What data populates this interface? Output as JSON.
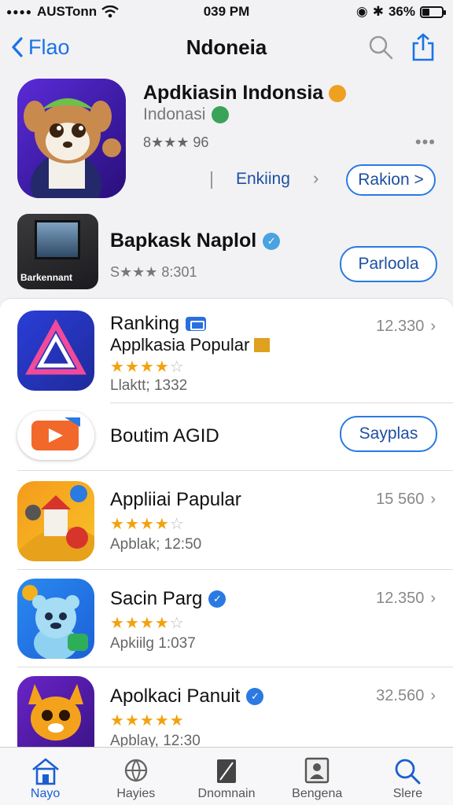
{
  "status": {
    "carrier": "AUSTonn",
    "time": "039 PM",
    "battery_text": "36%",
    "battery_level": 0.36
  },
  "nav": {
    "back_label": "Flao",
    "title": "Ndoneia"
  },
  "hero": {
    "title": "Apdkiasin Indonsia",
    "subtitle": "Indonasi",
    "rating": "8★★★ 96",
    "more": "•••",
    "link_label": "Enkiing",
    "button_label": "Rakion >"
  },
  "hero2": {
    "title": "Bapkask Naplol",
    "icon_caption": "Barkennant",
    "rating": "S★★★ 8:301",
    "button_label": "Parloola"
  },
  "list": {
    "rows": [
      {
        "title": "Ranking",
        "subtitle": "Applkasia Popular",
        "rating": 4,
        "meta": "Llaktt; 1332",
        "count": "12.330"
      },
      {
        "title": "Boutim AGID",
        "button_label": "Sayplas"
      },
      {
        "title": "Appliiai Papular",
        "rating": 4,
        "meta": "Apblak; 12:50",
        "count": "15 560"
      },
      {
        "title": "Sacin Parg",
        "rating": 4,
        "meta": "Apkiilg 1:037",
        "count": "12.350"
      },
      {
        "title": "Apolkaci Panuit",
        "rating": 4.5,
        "meta": "Apblay, 12:30",
        "count": "32.560"
      }
    ]
  },
  "tabs": [
    {
      "label": "Nayo",
      "icon": "home-icon"
    },
    {
      "label": "Hayies",
      "icon": "globe-icon"
    },
    {
      "label": "Dnomnain",
      "icon": "pen-icon"
    },
    {
      "label": "Bengena",
      "icon": "person-frame-icon"
    },
    {
      "label": "Slere",
      "icon": "search-icon"
    }
  ],
  "colors": {
    "accent": "#1a73e8",
    "star": "#f2a20f"
  }
}
